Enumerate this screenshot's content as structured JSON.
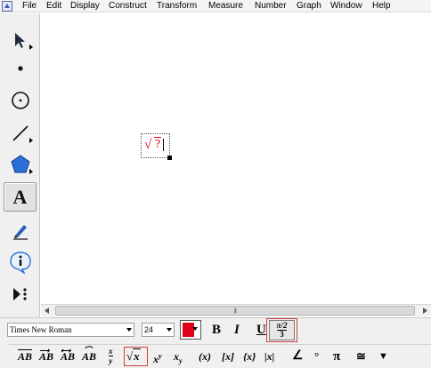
{
  "menubar": {
    "items": [
      "File",
      "Edit",
      "Display",
      "Construct",
      "Transform",
      "Measure",
      "Number",
      "Graph",
      "Window",
      "Help"
    ]
  },
  "toolbox": {
    "tools": [
      {
        "name": "arrow-tool-icon",
        "selected": false
      },
      {
        "name": "point-tool-icon",
        "selected": false
      },
      {
        "name": "compass-tool-icon",
        "selected": false
      },
      {
        "name": "straightedge-tool-icon",
        "selected": false
      },
      {
        "name": "polygon-tool-icon",
        "selected": false
      },
      {
        "name": "text-tool-icon",
        "selected": true
      },
      {
        "name": "marker-tool-icon",
        "selected": false
      },
      {
        "name": "information-tool-icon",
        "selected": false
      },
      {
        "name": "custom-tool-icon",
        "selected": false
      }
    ],
    "text_tool_label": "A"
  },
  "canvas": {
    "textbox": {
      "radical": "√",
      "placeholder": "?"
    }
  },
  "text_palette": {
    "font_family": "Times New Roman",
    "font_size": "24",
    "text_color": "#e1001a",
    "bold_label": "B",
    "italic_label": "I",
    "underline_label": "U",
    "math_format_top": "π/2",
    "math_format_bottom": "3"
  },
  "math_templates": {
    "overline_ab_1": "AB",
    "overline_ab_2": "AB",
    "overline_ab_3": "AB",
    "arc_ab": "AB",
    "fraction_num": "x",
    "fraction_den": "y",
    "sqrt_label": "x",
    "superscript_base": "x",
    "superscript_exp": "y",
    "subscript_base": "x",
    "subscript_sub": "y",
    "parens": "(x)",
    "brackets": "[x]",
    "braces": "{x}",
    "abs": "|x|",
    "angle": "∠",
    "degree": "°",
    "pi": "π",
    "congruent": "≅",
    "more": "▼"
  },
  "accent_color": "#d04040"
}
